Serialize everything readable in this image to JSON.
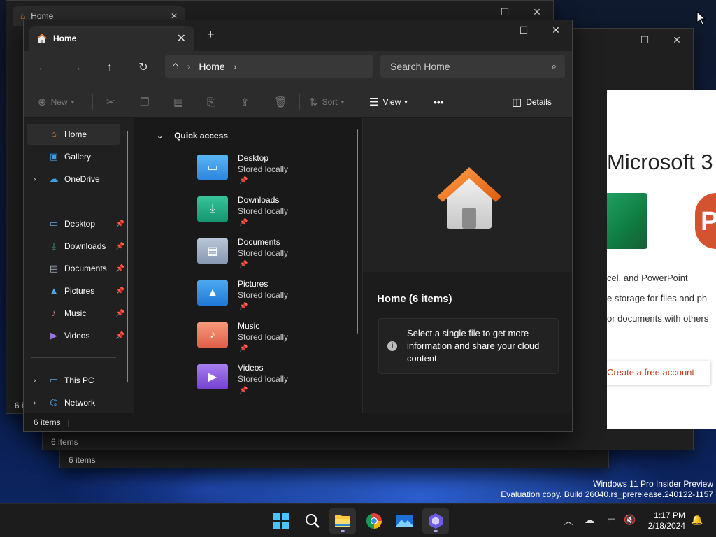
{
  "background_windows": [
    {
      "tab_title": "Home",
      "status": "6 items"
    },
    {
      "status": "6 items"
    },
    {
      "status": "6 items"
    }
  ],
  "ms365": {
    "title": "Microsoft 3",
    "lines": [
      "cel, and PowerPoint",
      "e storage for files and ph",
      "or documents with others"
    ],
    "button": "Create a free account",
    "ppt_letter": "P"
  },
  "window": {
    "tab_title": "Home",
    "address": {
      "crumb": "Home"
    },
    "search_placeholder": "Search Home",
    "toolbar": {
      "new": "New",
      "sort": "Sort",
      "view": "View",
      "more": "•••",
      "details": "Details"
    },
    "sidebar": {
      "top": [
        {
          "label": "Home",
          "icon": "home-icon",
          "selected": true
        },
        {
          "label": "Gallery",
          "icon": "gallery-icon"
        },
        {
          "label": "OneDrive",
          "icon": "onedrive-icon",
          "expandable": true
        }
      ],
      "pinned": [
        {
          "label": "Desktop",
          "icon": "desktop-icon"
        },
        {
          "label": "Downloads",
          "icon": "downloads-icon"
        },
        {
          "label": "Documents",
          "icon": "documents-icon"
        },
        {
          "label": "Pictures",
          "icon": "pictures-icon"
        },
        {
          "label": "Music",
          "icon": "music-icon"
        },
        {
          "label": "Videos",
          "icon": "videos-icon"
        }
      ],
      "bottom": [
        {
          "label": "This PC",
          "icon": "this-pc-icon",
          "expandable": true
        },
        {
          "label": "Network",
          "icon": "network-icon",
          "expandable": true
        }
      ]
    },
    "quick_access": {
      "header": "Quick access",
      "items": [
        {
          "name": "Desktop",
          "sub": "Stored locally",
          "color": "#3b9bef"
        },
        {
          "name": "Downloads",
          "sub": "Stored locally",
          "color": "#1aa47c"
        },
        {
          "name": "Documents",
          "sub": "Stored locally",
          "color": "#8a9bb5"
        },
        {
          "name": "Pictures",
          "sub": "Stored locally",
          "color": "#2f8be0"
        },
        {
          "name": "Music",
          "sub": "Stored locally",
          "color": "#e8745a"
        },
        {
          "name": "Videos",
          "sub": "Stored locally",
          "color": "#8a52d6"
        }
      ]
    },
    "details": {
      "title": "Home (6 items)",
      "info": "Select a single file to get more information and share your cloud content."
    },
    "status": "6 items"
  },
  "watermark": {
    "line1": "Windows 11 Pro Insider Preview",
    "line2": "Evaluation copy. Build 26040.rs_prerelease.240122-1157"
  },
  "taskbar": {
    "time": "1:17 PM",
    "date": "2/18/2024"
  },
  "colors": {
    "accent": "#c2a0ff",
    "ms_link": "#c43e1c"
  }
}
